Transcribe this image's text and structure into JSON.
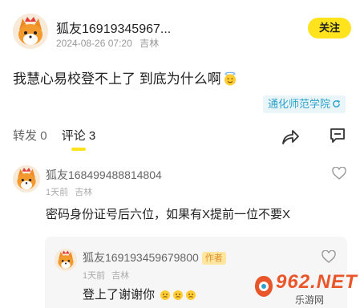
{
  "post": {
    "username": "狐友16919345967...",
    "date": "2024-08-26 07:20",
    "location": "吉林",
    "follow_label": "关注",
    "body": "我慧心易校登不上了 到底为什么啊",
    "tag": "通化师范学院"
  },
  "tabs": [
    {
      "label": "转发",
      "count": "0"
    },
    {
      "label": "评论",
      "count": "3"
    }
  ],
  "comments": [
    {
      "username": "狐友168499488814804",
      "time": "1天前",
      "location": "吉林",
      "text": "密码身份证号后六位，如果有X提前一位不要X"
    }
  ],
  "reply": {
    "username": "狐友16919345967980​0",
    "badge": "作者",
    "time": "1天前",
    "location": "吉林",
    "text": "登上了谢谢你"
  },
  "watermark": {
    "brand": "962.NET",
    "sub": "乐游网"
  },
  "colors": {
    "accent_yellow": "#ffe31c",
    "tag_blue": "#2ea3c9"
  }
}
